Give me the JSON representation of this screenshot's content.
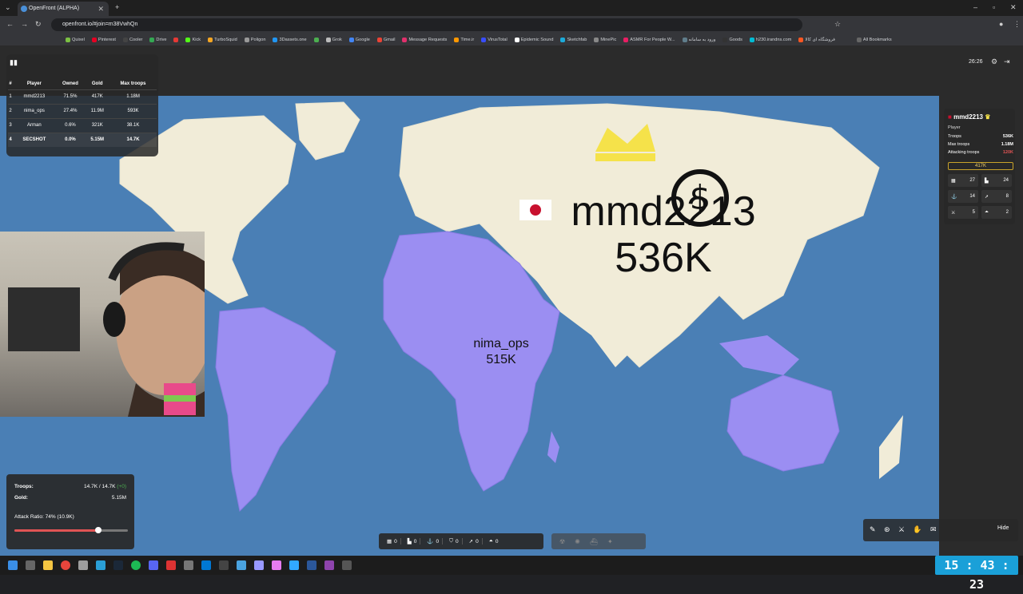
{
  "browser": {
    "tab_title": "OpenFront (ALPHA)",
    "url": "openfront.io/#join=m38VwhQn",
    "bookmarks": [
      "Quixel",
      "Pinterest",
      "Cooler",
      "Drive",
      "",
      "Kick",
      "TurboSquid",
      "Poligon",
      "3Dassets.one",
      "",
      "Grok",
      "Google",
      "Gmail",
      "Message Requests",
      "Time.ir",
      "VirusTotal",
      "Epidemic Sound",
      "Sketchfab",
      "MinePic",
      "ASMR For People W...",
      "ورود به سامانه",
      "Goods",
      "h230.irandns.com",
      "فروشگاه ای کالا"
    ],
    "all_bookmarks": "All Bookmarks"
  },
  "leaderboard": {
    "headers": [
      "#",
      "Player",
      "Owned",
      "Gold",
      "Max troops"
    ],
    "rows": [
      {
        "rank": "1",
        "player": "mmd2213",
        "owned": "71.5%",
        "gold": "417K",
        "max_troops": "1.18M"
      },
      {
        "rank": "2",
        "player": "nima_ops",
        "owned": "27.4%",
        "gold": "11.9M",
        "max_troops": "593K"
      },
      {
        "rank": "3",
        "player": "Arman",
        "owned": "0.6%",
        "gold": "321K",
        "max_troops": "38.1K"
      },
      {
        "rank": "4",
        "player": "SECSHOT",
        "owned": "0.0%",
        "gold": "5.15M",
        "max_troops": "14.7K"
      }
    ]
  },
  "timer": "26:26",
  "player_panel": {
    "name": "mmd2213",
    "type": "Player",
    "stats": [
      {
        "label": "Troops",
        "value": "536K"
      },
      {
        "label": "Max troops",
        "value": "1.18M"
      },
      {
        "label": "Attacking troops",
        "value": "120K"
      }
    ],
    "gold": "417K",
    "structures": [
      {
        "icon": "city-icon",
        "value": "27"
      },
      {
        "icon": "factory-icon",
        "value": "24"
      },
      {
        "icon": "port-icon",
        "value": "14"
      },
      {
        "icon": "missile-silo-icon",
        "value": "8"
      },
      {
        "icon": "defense-post-icon",
        "value": "5"
      },
      {
        "icon": "sam-launcher-icon",
        "value": "2"
      }
    ]
  },
  "map_labels": {
    "big_name": "mmd2213",
    "big_troops": "536K",
    "small_name": "nima_ops",
    "small_troops": "515K"
  },
  "status": {
    "troops_label": "Troops:",
    "troops_value": "14.7K / 14.7K",
    "troops_delta": "(+0)",
    "gold_label": "Gold:",
    "gold_value": "5.15M",
    "attack_ratio_label": "Attack Ratio: 74% (10.9K)",
    "attack_ratio": 0.74
  },
  "build_bar": [
    "0",
    "0",
    "0",
    "0",
    "0",
    "0"
  ],
  "chat": {
    "hide_label": "Hide"
  },
  "taskbar": {
    "clock": "15 : 43 : 23"
  },
  "colors": {
    "ocean": "#4a7fb5",
    "land": "#f1ecd8",
    "nima_territory": "#9b8ef2",
    "mmd_border": "#f0f0f0",
    "clock_bg": "#1aa0d8"
  }
}
